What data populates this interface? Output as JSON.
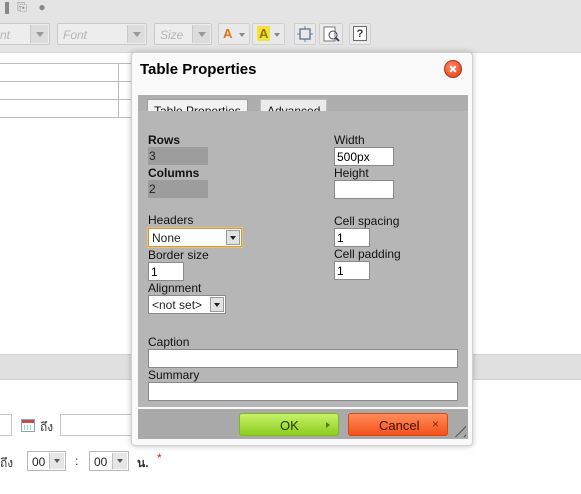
{
  "editor": {
    "toolbar": {
      "style_combo": {
        "placeholder": "nt"
      },
      "font_combo": {
        "placeholder": "Font"
      },
      "size_combo": {
        "placeholder": "Size"
      },
      "text_color_glyph": "A",
      "bg_color_glyph": "A",
      "maximize_icon": "maximize-icon",
      "preview_icon": "preview-icon",
      "help_glyph": "?"
    },
    "colors": {
      "bg_color_highlight": "#f4e23a",
      "text_color_accent": "#e0751b"
    }
  },
  "form": {
    "date_to_label": "ถึง",
    "time_to_label": "ถึง",
    "hour_value": "00",
    "minute_value": "00",
    "time_separator": ":",
    "minute_unit": "น.",
    "required_mark": "*"
  },
  "dialog": {
    "title": "Table Properties",
    "tabs": [
      {
        "label": "Table Properties",
        "active": true
      },
      {
        "label": "Advanced",
        "active": false
      }
    ],
    "rows": {
      "label": "Rows",
      "value": "3"
    },
    "columns": {
      "label": "Columns",
      "value": "2"
    },
    "width": {
      "label": "Width",
      "value": "500px"
    },
    "height": {
      "label": "Height",
      "value": ""
    },
    "headers": {
      "label": "Headers",
      "value": "None"
    },
    "cell_spacing": {
      "label": "Cell spacing",
      "value": "1"
    },
    "border_size": {
      "label": "Border size",
      "value": "1"
    },
    "cell_padding": {
      "label": "Cell padding",
      "value": "1"
    },
    "alignment": {
      "label": "Alignment",
      "value": "<not set>"
    },
    "caption": {
      "label": "Caption",
      "value": ""
    },
    "summary": {
      "label": "Summary",
      "value": ""
    },
    "ok_label": "OK",
    "cancel_label": "Cancel",
    "cancel_glyph": "×"
  }
}
